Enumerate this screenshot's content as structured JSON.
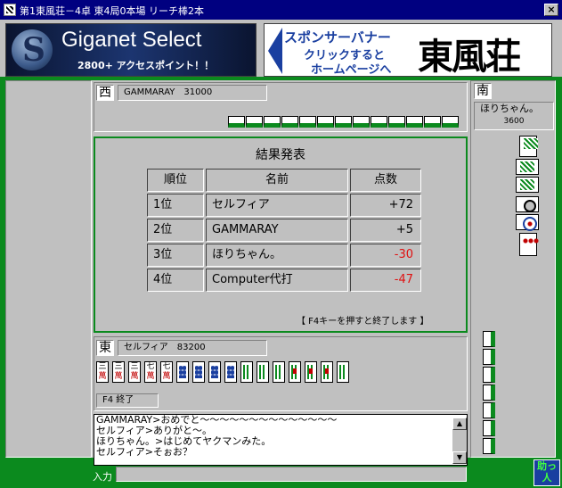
{
  "window": {
    "title": "第1東風荘－4卓 東4局0本場 リーチ棒2本",
    "close_label": "×"
  },
  "banner_left": {
    "brand": "Giganet Select",
    "tagline": "2800+ アクセスポイント！！"
  },
  "banner_right": {
    "line1": "スポンサーバナー",
    "line2": "クリックすると",
    "line3": "ホームページへ",
    "brand": "東風荘"
  },
  "west": {
    "seat": "西",
    "name_score": "GAMMARAY　31000",
    "hidden_tiles": 13
  },
  "south": {
    "seat": "南",
    "name": "ほりちゃん。",
    "score": "3600"
  },
  "east": {
    "seat": "東",
    "name_score": "セルフィア　83200",
    "f4_label": "F4 終了"
  },
  "results": {
    "title": "結果発表",
    "headers": {
      "rank": "順位",
      "name": "名前",
      "points": "点数"
    },
    "rows": [
      {
        "rank": "1位",
        "name": "セルフィア",
        "points": "+72",
        "negative": false
      },
      {
        "rank": "2位",
        "name": "GAMMARAY",
        "points": "+5",
        "negative": false
      },
      {
        "rank": "3位",
        "name": "ほりちゃん。",
        "points": "-30",
        "negative": true
      },
      {
        "rank": "4位",
        "name": "Computer代打",
        "points": "-47",
        "negative": true
      }
    ],
    "hint": "【 F4キーを押すと終了します 】"
  },
  "east_hand": [
    {
      "suit": "man",
      "top": "三",
      "bottom": "萬"
    },
    {
      "suit": "man",
      "top": "三",
      "bottom": "萬"
    },
    {
      "suit": "man",
      "top": "三",
      "bottom": "萬"
    },
    {
      "suit": "man",
      "top": "七",
      "bottom": "萬"
    },
    {
      "suit": "man",
      "top": "七",
      "bottom": "萬"
    },
    {
      "suit": "pin"
    },
    {
      "suit": "pin"
    },
    {
      "suit": "pin"
    },
    {
      "suit": "pin"
    },
    {
      "suit": "sou"
    },
    {
      "suit": "sou"
    },
    {
      "suit": "sou"
    },
    {
      "suit": "sou",
      "red": true
    },
    {
      "suit": "sou",
      "red": true
    },
    {
      "suit": "sou",
      "red": true
    },
    {
      "suit": "sou"
    }
  ],
  "chat": {
    "lines": [
      "GAMMARAY>おめでと～～～～～～～～～～～～～～",
      "セルフィア>ありがと～。",
      "ほりちゃん。>はじめてヤクマンみた。",
      "セルフィア>そぉお？"
    ],
    "scroll_up": "▲",
    "scroll_down": "▼"
  },
  "input": {
    "label": "入力",
    "value": ""
  },
  "sukedachi": {
    "label": "助っ人"
  },
  "colors": {
    "felt_green": "#0b8a1e",
    "title_bar": "#000080",
    "negative_points": "#e01010"
  }
}
